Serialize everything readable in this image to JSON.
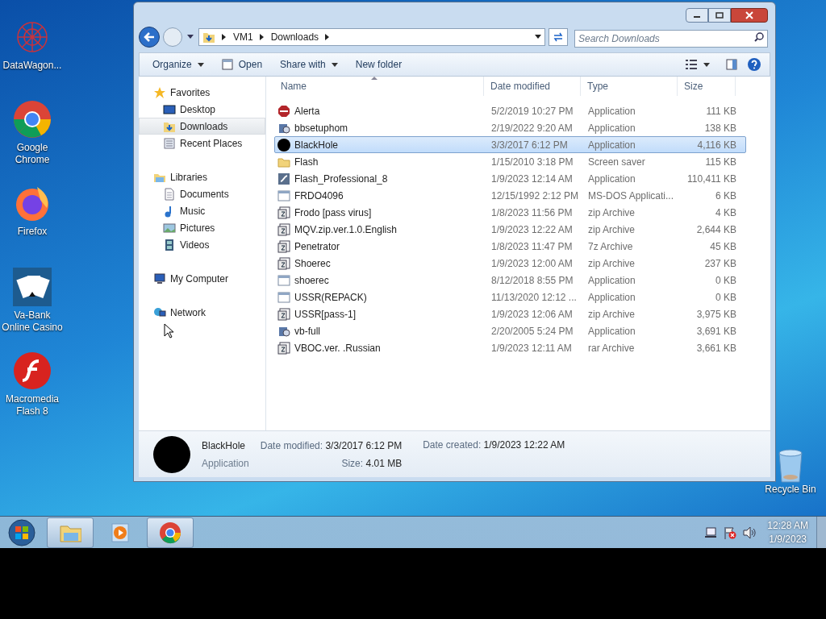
{
  "desktop_icons": [
    {
      "label": "DataWagon...",
      "kind": "web"
    },
    {
      "label": "Google Chrome",
      "kind": "chrome"
    },
    {
      "label": "Firefox",
      "kind": "firefox"
    },
    {
      "label": "Va-Bank Online Casino",
      "kind": "cards"
    },
    {
      "label": "Macromedia Flash 8",
      "kind": "flash"
    }
  ],
  "recycle_bin": {
    "label": "Recycle Bin"
  },
  "explorer": {
    "address": [
      "VM1",
      "Downloads"
    ],
    "search": {
      "placeholder": "Search Downloads"
    },
    "toolbar": [
      {
        "label": "Organize",
        "kind": "menu"
      },
      {
        "label": "Open",
        "kind": "open"
      },
      {
        "label": "Share with",
        "kind": "menu"
      },
      {
        "label": "New folder",
        "kind": "plain"
      }
    ],
    "nav": [
      {
        "label": "Favorites",
        "kind": "star",
        "selected": false,
        "children": [
          {
            "label": "Desktop",
            "kind": "desktop",
            "selected": false
          },
          {
            "label": "Downloads",
            "kind": "downloads",
            "selected": true
          },
          {
            "label": "Recent Places",
            "kind": "recent",
            "selected": false
          }
        ]
      },
      {
        "label": "Libraries",
        "kind": "library",
        "selected": false,
        "children": [
          {
            "label": "Documents",
            "kind": "document",
            "selected": false
          },
          {
            "label": "Music",
            "kind": "music",
            "selected": false
          },
          {
            "label": "Pictures",
            "kind": "picture",
            "selected": false
          },
          {
            "label": "Videos",
            "kind": "video",
            "selected": false
          }
        ]
      },
      {
        "label": "My Computer",
        "kind": "computer",
        "selected": false
      },
      {
        "label": "Network",
        "kind": "network",
        "selected": false
      }
    ],
    "columns": [
      "Name",
      "Date modified",
      "Type",
      "Size"
    ],
    "rows": [
      {
        "name": "Alerta",
        "date": "5/2/2019 10:27 PM",
        "type": "Application",
        "size": "111 KB",
        "kind": "stop",
        "selected": false
      },
      {
        "name": "bbsetuphom",
        "date": "2/19/2022 9:20 AM",
        "type": "Application",
        "size": "138 KB",
        "kind": "setup",
        "selected": false
      },
      {
        "name": "BlackHole",
        "date": "3/3/2017 6:12 PM",
        "type": "Application",
        "size": "4,116 KB",
        "kind": "disc",
        "selected": true
      },
      {
        "name": "Flash",
        "date": "1/15/2010 3:18 PM",
        "type": "Screen saver",
        "size": "115 KB",
        "kind": "folder",
        "selected": false
      },
      {
        "name": "Flash_Professional_8",
        "date": "1/9/2023 12:14 AM",
        "type": "Application",
        "size": "110,411 KB",
        "kind": "app",
        "selected": false
      },
      {
        "name": "FRDO4096",
        "date": "12/15/1992 2:12 PM",
        "type": "MS-DOS Applicati...",
        "size": "6 KB",
        "kind": "window",
        "selected": false
      },
      {
        "name": "Frodo [pass virus]",
        "date": "1/8/2023 11:56 PM",
        "type": "zip Archive",
        "size": "4 KB",
        "kind": "archive",
        "selected": false
      },
      {
        "name": "MQV.zip.ver.1.0.English",
        "date": "1/9/2023 12:22 AM",
        "type": "zip Archive",
        "size": "2,644 KB",
        "kind": "archive",
        "selected": false
      },
      {
        "name": "Penetrator",
        "date": "1/8/2023 11:47 PM",
        "type": "7z Archive",
        "size": "45 KB",
        "kind": "archive",
        "selected": false
      },
      {
        "name": "Shoerec",
        "date": "1/9/2023 12:00 AM",
        "type": "zip Archive",
        "size": "237 KB",
        "kind": "archive",
        "selected": false
      },
      {
        "name": "shoerec",
        "date": "8/12/2018 8:55 PM",
        "type": "Application",
        "size": "0 KB",
        "kind": "window",
        "selected": false
      },
      {
        "name": "USSR(REPACK)",
        "date": "11/13/2020 12:12 ...",
        "type": "Application",
        "size": "0 KB",
        "kind": "window",
        "selected": false
      },
      {
        "name": "USSR[pass-1]",
        "date": "1/9/2023 12:06 AM",
        "type": "zip Archive",
        "size": "3,975 KB",
        "kind": "archive",
        "selected": false
      },
      {
        "name": "vb-full",
        "date": "2/20/2005 5:24 PM",
        "type": "Application",
        "size": "3,691 KB",
        "kind": "setup",
        "selected": false
      },
      {
        "name": "VBOC.ver. .Russian",
        "date": "1/9/2023 12:11 AM",
        "type": "rar Archive",
        "size": "3,661 KB",
        "kind": "archive",
        "selected": false
      }
    ],
    "details": {
      "name": "BlackHole",
      "type": "Application",
      "fields": [
        {
          "label": "Date modified:",
          "value": "3/3/2017 6:12 PM"
        },
        {
          "label": "Date created:",
          "value": "1/9/2023 12:22 AM"
        },
        {
          "label": "Size:",
          "value": "4.01 MB"
        }
      ]
    }
  },
  "taskbar": {
    "items": [
      {
        "kind": "explorer",
        "running": true
      },
      {
        "kind": "media",
        "running": false
      },
      {
        "kind": "chrome",
        "running": true
      }
    ],
    "clock": {
      "time": "12:28 AM",
      "date": "1/9/2023"
    }
  }
}
